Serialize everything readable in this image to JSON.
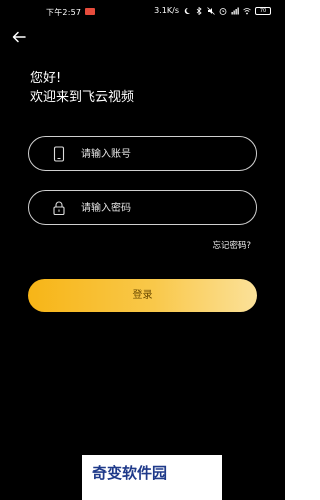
{
  "status_bar": {
    "time": "下午2:57",
    "speed": "3.1K/s",
    "battery": "70"
  },
  "header": {
    "back_icon": "arrow-left-icon"
  },
  "greeting": {
    "line1": "您好!",
    "line2": "欢迎来到飞云视频"
  },
  "form": {
    "account_placeholder": "请输入账号",
    "account_icon": "phone-icon",
    "password_placeholder": "请输入密码",
    "password_icon": "lock-icon",
    "forgot_label": "忘记密码?",
    "login_label": "登录"
  },
  "colors": {
    "background": "#000000",
    "accent_start": "#f7b517",
    "accent_end": "#fbe199"
  },
  "watermark": {
    "text": "奇变软件园"
  }
}
